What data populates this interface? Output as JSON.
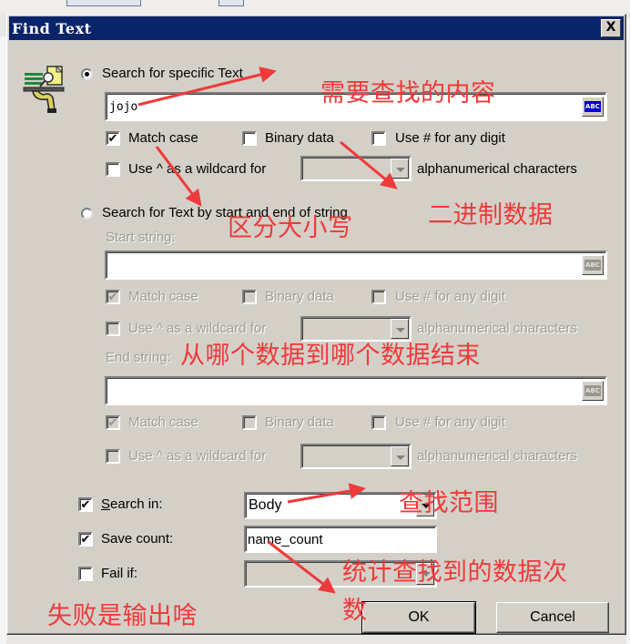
{
  "window": {
    "title": "Find Text",
    "close_label": "X"
  },
  "specific": {
    "radio_label": "Search for specific Text",
    "selected": true,
    "value": "jojo",
    "abc_label": "ABC",
    "match_case": {
      "label": "Match case",
      "checked": true
    },
    "binary_data": {
      "label": "Binary data",
      "checked": false
    },
    "use_hash": {
      "label": "Use # for any digit",
      "checked": false
    },
    "wildcard": {
      "label": "Use ^ as a wildcard for",
      "checked": false
    },
    "wildcard_select": "",
    "alnum_label": "alphanumerical characters"
  },
  "startend": {
    "radio_label": "Search for Text by start and end of string",
    "selected": false,
    "start_label": "Start string:",
    "start_value": "",
    "end_label": "End string:",
    "end_value": "",
    "abc_label": "ABC",
    "start_opts": {
      "match_case": {
        "label": "Match case",
        "checked": true
      },
      "binary_data": {
        "label": "Binary data",
        "checked": false
      },
      "use_hash": {
        "label": "Use # for any digit",
        "checked": false
      },
      "wildcard": {
        "label": "Use ^ as a wildcard for",
        "checked": false
      },
      "alnum_label": "alphanumerical characters"
    },
    "end_opts": {
      "match_case": {
        "label": "Match case",
        "checked": true
      },
      "binary_data": {
        "label": "Binary data",
        "checked": false
      },
      "use_hash": {
        "label": "Use # for any digit",
        "checked": false
      },
      "wildcard": {
        "label": "Use ^ as a wildcard for",
        "checked": false
      },
      "alnum_label": "alphanumerical characters"
    }
  },
  "options": {
    "search_in": {
      "label": "Search in:",
      "checked": true,
      "value": "Body"
    },
    "save_count": {
      "label": "Save count:",
      "checked": true,
      "value": "name_count"
    },
    "fail_if": {
      "label": "Fail if:",
      "checked": false,
      "value": ""
    }
  },
  "buttons": {
    "ok": "OK",
    "cancel": "Cancel"
  },
  "annotations": {
    "content_to_find": "需要查找的内容",
    "binary_data": "二进制数据",
    "case_sensitive": "区分大小写",
    "from_to": "从哪个数据到哪个数据结束",
    "search_scope": "查找范围",
    "count_line1": "统计查找到的数据次",
    "count_line2": "数",
    "fail_output": "失败是输出啥"
  },
  "colors": {
    "titlebar": "#0a246a",
    "dialog_bg": "#d4d0c8",
    "annotation": "#f0393a"
  }
}
